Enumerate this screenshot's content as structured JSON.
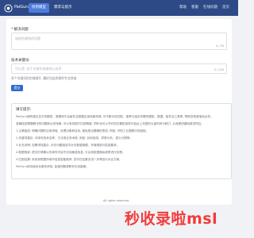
{
  "header": {
    "brand": "PaiGuru",
    "tabs": [
      {
        "label": "找到模型",
        "active": true
      },
      {
        "label": "需求与提示",
        "active": false
      }
    ],
    "right_links": [
      "帮助",
      "客服",
      "在线问题",
      "首页"
    ]
  },
  "form": {
    "field1": {
      "label": "* 解决问题",
      "placeholder": "描述你遇到的问题",
      "count": "0 / 50"
    },
    "field2": {
      "label": "技术关键词",
      "placeholder": "可以是: 若干关键字或者核心技术",
      "count": "0 / 100"
    },
    "hint": "多个关键词用空格隔开, 最好包括所需的专业领域",
    "submit_label": "提交"
  },
  "tips": {
    "title": "填写提示:",
    "lines": [
      "PaiGuru拥有超过百万的模型、数据和平台组件及数据应用场景资源, 可不断为您匹配、推荐与组合所需的模型、数据、组件及工具等, 帮助您快速落地业务。",
      "准确描述需要解决的问题和业务场景, 可以有效提升匹配精度, 同时也可以节约您在模型选择与验证上花费的大量时间与精力, 从而更快捷地推进项目。",
      "1.正确描述: 明确问题的应用领域、处理对象和目标, 避免宽泛模糊的表述, 例如: 识别工业图像中的缺陷。",
      "2.关键词建议: 可填写技术名称、方法或业务术语, 例如: 目标检测、异常分析、语义分割等。",
      "3.补充说明: 如需求较复杂, 可在问题描述中补充数据规模、环境限制与性能要求。",
      "4.数据授权: 提交时请确认所填写内容不涉及敏感信息, 平台将依据隐私政策进行处理。",
      "5.匹配结果: 系统将根据所填写信息智能推荐, 您可在结果页进一步筛选与对比方案。",
      "PaiGuru将持续优化服务体验, 如遇问题请联系在线客服。"
    ]
  },
  "footer": {
    "text": "All rights reserved."
  },
  "watermark": {
    "text": "秒收录啦msl"
  }
}
